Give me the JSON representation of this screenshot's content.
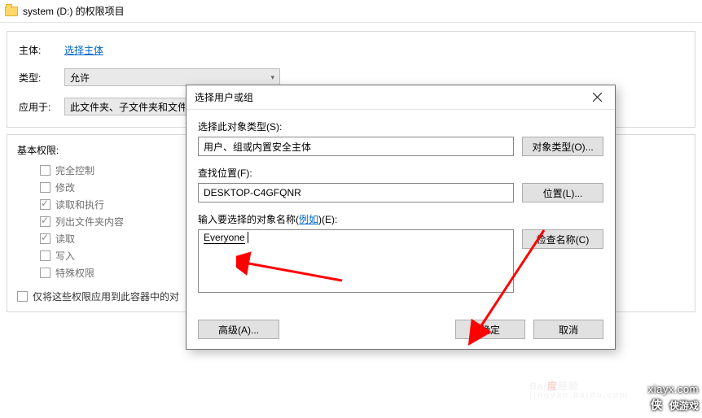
{
  "window": {
    "title": "system (D:) 的权限项目"
  },
  "form": {
    "subject_label": "主体:",
    "subject_link": "选择主体",
    "type_label": "类型:",
    "type_value": "允许",
    "apply_label": "应用于:",
    "apply_value": "此文件夹、子文件夹和文件"
  },
  "permissions": {
    "title": "基本权限:",
    "items": [
      {
        "label": "完全控制",
        "checked": false
      },
      {
        "label": "修改",
        "checked": false
      },
      {
        "label": "读取和执行",
        "checked": true
      },
      {
        "label": "列出文件夹内容",
        "checked": true
      },
      {
        "label": "读取",
        "checked": true
      },
      {
        "label": "写入",
        "checked": false
      },
      {
        "label": "特殊权限",
        "checked": false
      }
    ],
    "container_only": "仅将这些权限应用到此容器中的对"
  },
  "dialog": {
    "title": "选择用户或组",
    "object_type_label": "选择此对象类型(S):",
    "object_type_value": "用户、组或内置安全主体",
    "object_type_btn": "对象类型(O)...",
    "location_label": "查找位置(F):",
    "location_value": "DESKTOP-C4GFQNR",
    "location_btn": "位置(L)...",
    "names_label_prefix": "输入要选择的对象名称(",
    "names_label_link": "例如",
    "names_label_suffix": ")(E):",
    "names_value": "Everyone",
    "check_btn": "检查名称(C)",
    "advanced_btn": "高级(A)...",
    "ok_btn": "确定",
    "cancel_btn": "取消"
  },
  "watermark": {
    "site": "xiayx.com",
    "brand": "侠游戏",
    "baidu": "Bai",
    "baidu2": "经验",
    "baidu_sub": "jingyan.baidu.com"
  }
}
